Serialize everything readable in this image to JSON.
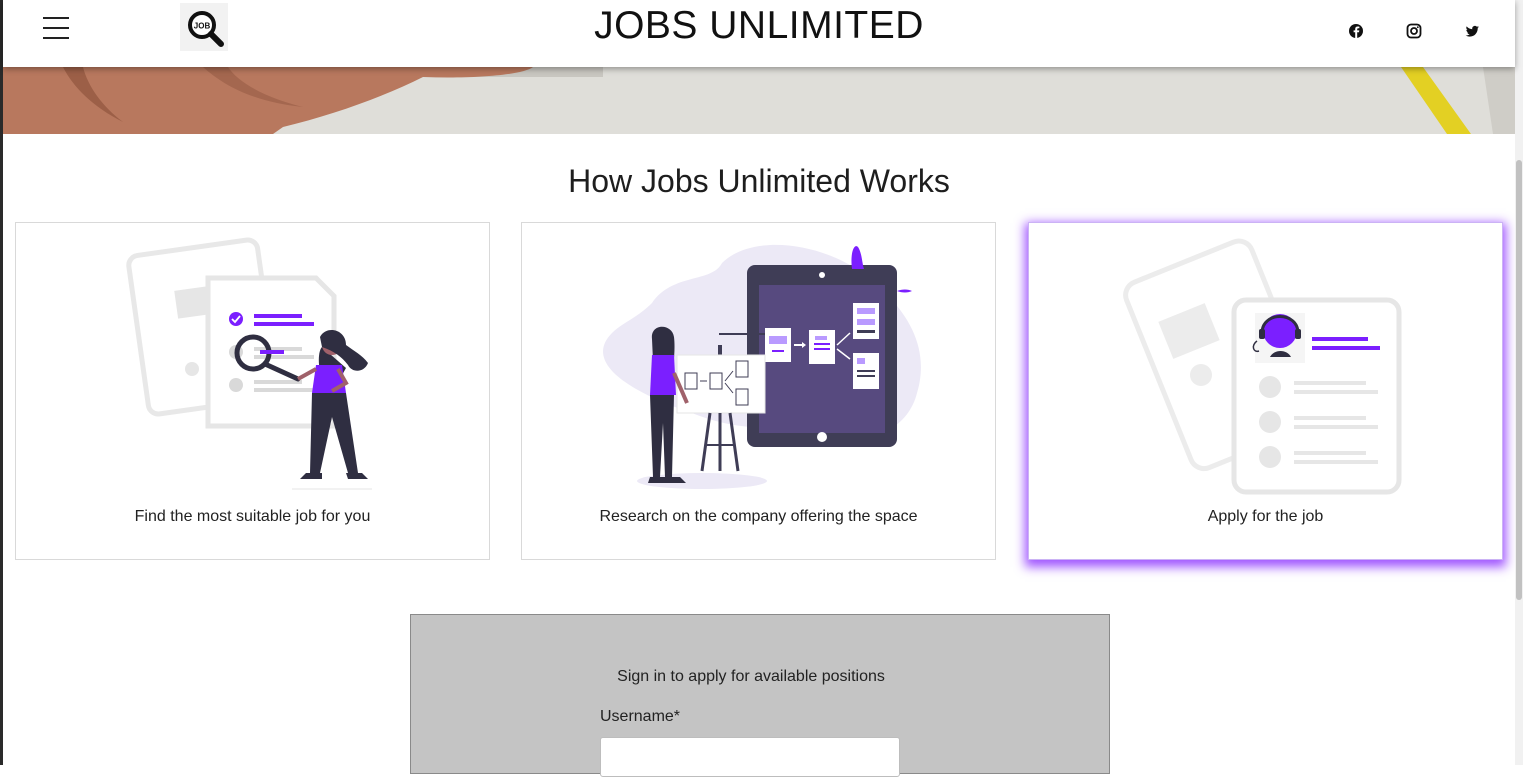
{
  "header": {
    "title": "JOBS UNLIMITED",
    "logo_text": "JOB",
    "menu_icon": "hamburger-icon",
    "social_icons": [
      "facebook-icon",
      "instagram-icon",
      "twitter-icon"
    ]
  },
  "how_it_works": {
    "heading": "How Jobs Unlimited Works",
    "steps": [
      {
        "caption": "Find the most suitable job for you",
        "illustration": "woman-with-magnifier"
      },
      {
        "caption": "Research on the company offering the space",
        "illustration": "woman-presenting-flowchart"
      },
      {
        "caption": "Apply for the job",
        "illustration": "profile-card-applicant"
      }
    ]
  },
  "signin": {
    "title": "Sign in to apply for available positions",
    "username_label": "Username*",
    "username_value": ""
  },
  "colors": {
    "accent": "#7b1fff",
    "dark_purple": "#2f2e41",
    "panel_gray": "#c4c4c4",
    "hero_hand": "#b9755b",
    "hero_yellow": "#e8d52a"
  }
}
